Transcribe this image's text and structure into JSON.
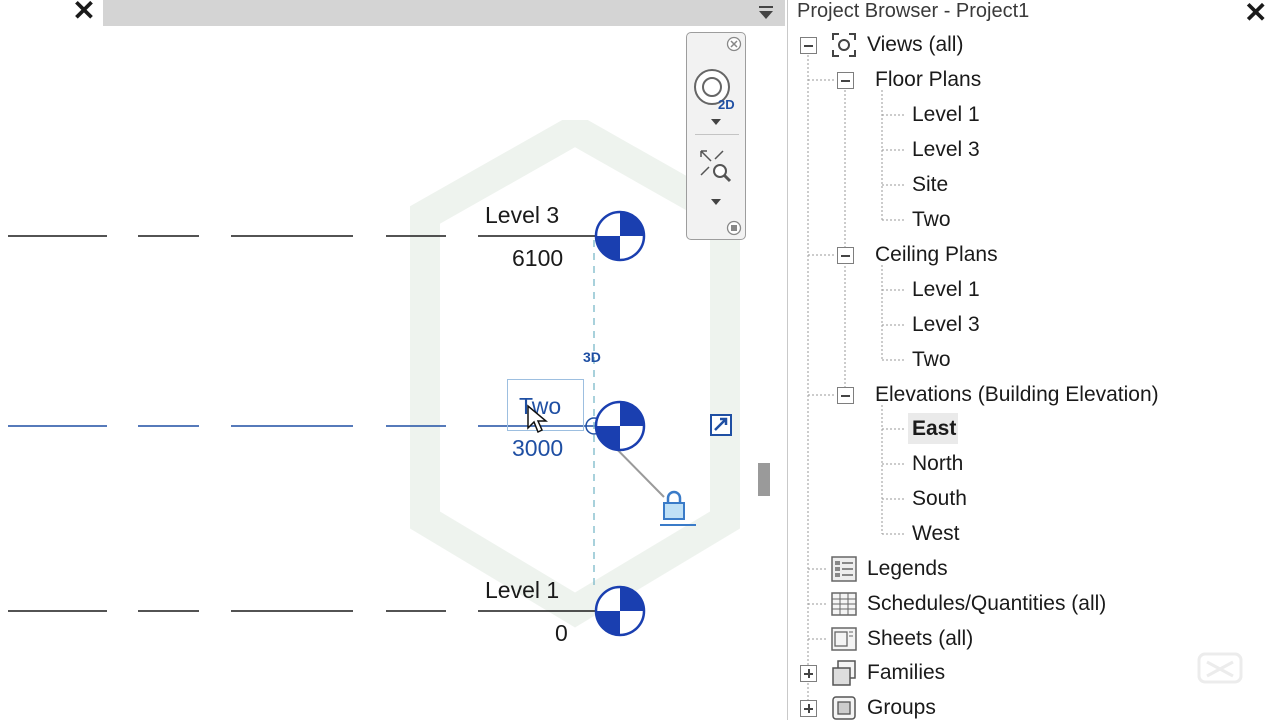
{
  "view": {
    "tab_close": "✕",
    "menu_icon": "chevron-down-icon",
    "levels": [
      {
        "name": "Level 3",
        "elevation": "6100"
      },
      {
        "name": "Two",
        "elevation": "3000",
        "selected": true
      },
      {
        "name": "Level 1",
        "elevation": "0"
      }
    ],
    "tag_3d": "3D",
    "navbar": {
      "wheel_tag": "2D"
    }
  },
  "project_browser": {
    "title": "Project Browser - Project1",
    "close": "✕",
    "root": "Views (all)",
    "floor_plans": {
      "label": "Floor Plans",
      "items": [
        "Level 1",
        "Level 3",
        "Site",
        "Two"
      ]
    },
    "ceiling_plans": {
      "label": "Ceiling Plans",
      "items": [
        "Level 1",
        "Level 3",
        "Two"
      ]
    },
    "elevations": {
      "label": "Elevations (Building Elevation)",
      "items": [
        "East",
        "North",
        "South",
        "West"
      ],
      "selected": "East"
    },
    "legends": "Legends",
    "schedules": "Schedules/Quantities (all)",
    "sheets": "Sheets (all)",
    "families": "Families",
    "groups": "Groups"
  },
  "colors": {
    "accent": "#1f4fa3",
    "level_head_blue": "#1a3fb0",
    "tree_line": "#9a9a9a"
  }
}
